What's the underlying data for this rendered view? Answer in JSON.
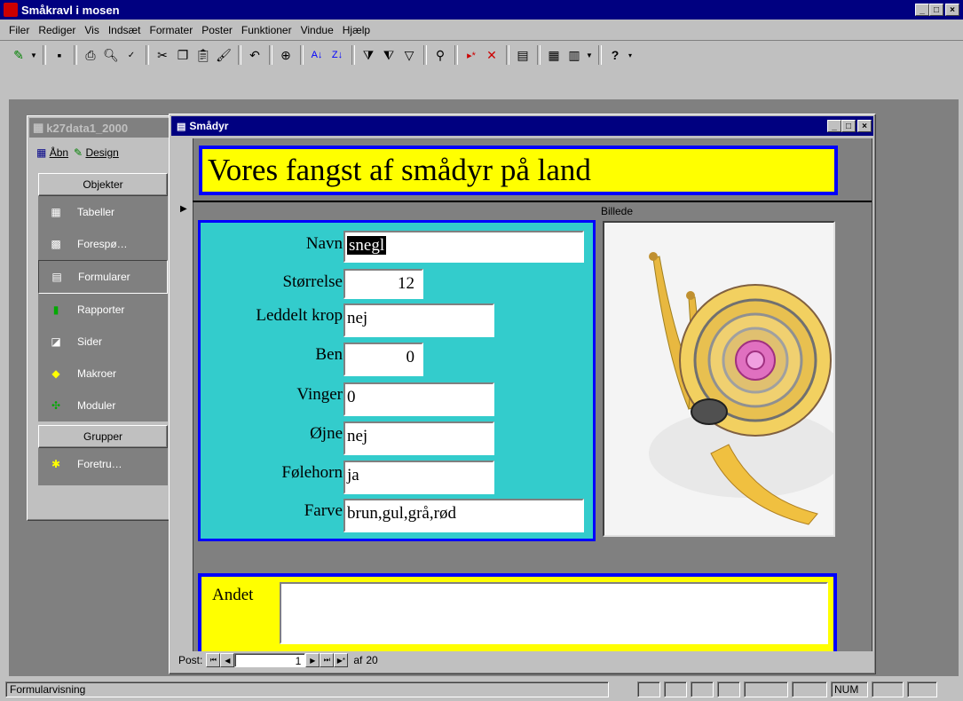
{
  "app": {
    "title": "Småkravl i mosen"
  },
  "menu": [
    "Filer",
    "Rediger",
    "Vis",
    "Indsæt",
    "Formater",
    "Poster",
    "Funktioner",
    "Vindue",
    "Hjælp"
  ],
  "db_window": {
    "title": "k27data1_2000",
    "open_label": "Åbn",
    "design_label": "Design",
    "objects_header": "Objekter",
    "items": [
      {
        "label": "Tabeller",
        "icon": "table-icon"
      },
      {
        "label": "Forespø…",
        "icon": "query-icon"
      },
      {
        "label": "Formularer",
        "icon": "form-icon"
      },
      {
        "label": "Rapporter",
        "icon": "report-icon"
      },
      {
        "label": "Sider",
        "icon": "page-icon"
      },
      {
        "label": "Makroer",
        "icon": "macro-icon"
      },
      {
        "label": "Moduler",
        "icon": "module-icon"
      }
    ],
    "groups_header": "Grupper",
    "group_items": [
      {
        "label": "Foretru…",
        "icon": "favorites-icon"
      }
    ]
  },
  "form_window": {
    "title": "Smådyr",
    "header_title": "Vores fangst af smådyr på land",
    "picture_label": "Billede",
    "fields": [
      {
        "label": "Navn",
        "value": "snegl"
      },
      {
        "label": "Størrelse",
        "value": "12"
      },
      {
        "label": "Leddelt krop",
        "value": "nej"
      },
      {
        "label": "Ben",
        "value": "0"
      },
      {
        "label": "Vinger",
        "value": "0"
      },
      {
        "label": "Øjne",
        "value": "nej"
      },
      {
        "label": "Følehorn",
        "value": "ja"
      },
      {
        "label": "Farve",
        "value": "brun,gul,grå,rød"
      }
    ],
    "other_label": "Andet",
    "other_value": "",
    "nav": {
      "post_label": "Post:",
      "current": "1",
      "of_label": "af",
      "total": "20"
    }
  },
  "statusbar": {
    "text": "Formularvisning",
    "num": "NUM"
  },
  "colors": {
    "titlebar": "#000080",
    "form_bg": "#808080",
    "yellow": "#ffff00",
    "teal": "#33cccc",
    "blue_border": "#0000ff"
  }
}
